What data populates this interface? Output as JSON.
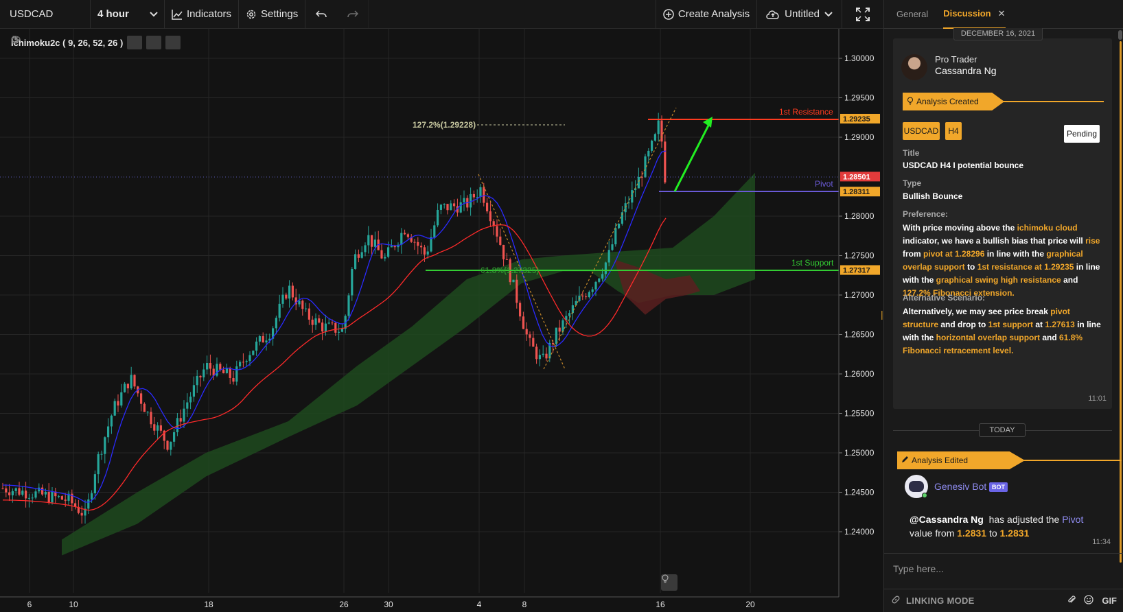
{
  "toolbar": {
    "symbol": "USDCAD",
    "interval": "4 hour",
    "indicators_label": "Indicators",
    "settings_label": "Settings",
    "create_analysis_label": "Create Analysis",
    "layout_name": "Untitled"
  },
  "chart": {
    "indicator_legend": "Ichimoku2c ( 9, 26, 52, 26 )",
    "price_axis": [
      "1.30000",
      "1.29500",
      "1.29000",
      "1.28000",
      "1.27500",
      "1.27000",
      "1.26500",
      "1.26000",
      "1.25500",
      "1.25000",
      "1.24500",
      "1.24000"
    ],
    "time_axis": [
      "6",
      "10",
      "18",
      "26",
      "30",
      "4",
      "8",
      "16",
      "20"
    ],
    "price_labels": [
      {
        "name": "resistance",
        "value": "1.29235",
        "color": "#f1a72a"
      },
      {
        "name": "last",
        "value": "1.28501",
        "color": "#e23b3b"
      },
      {
        "name": "pivot",
        "value": "1.28311",
        "color": "#f1a72a"
      },
      {
        "name": "support",
        "value": "1.27317",
        "color": "#f1a72a"
      }
    ],
    "annotations": {
      "resistance": "1st Resistance",
      "pivot": "Pivot",
      "support": "1st Support",
      "fib_ext": "127.2%(1.29228)",
      "fib_ret": "61.8%(1.27325)"
    },
    "colors": {
      "up": "#26a69a",
      "down": "#ef5350",
      "tenkan": "#2a2aff",
      "kijun": "#ff2a2a",
      "cloud_bull": "#1f4a1f",
      "cloud_bear": "#5a2020"
    }
  },
  "panel": {
    "tabs": [
      "General",
      "Discussion"
    ],
    "active_tab": "Discussion",
    "date_separator": "DECEMBER 16, 2021",
    "author_role": "Pro Trader",
    "author_name": "Cassandra Ng",
    "created_banner": "Analysis Created",
    "tag_symbol": "USDCAD",
    "tag_timeframe": "H4",
    "status": "Pending",
    "title_label": "Title",
    "title_value": "USDCAD H4 I potential bounce",
    "type_label": "Type",
    "type_value": "Bullish Bounce",
    "preference_label": "Preference:",
    "alternative_label": "Alternative Scenario:",
    "message_time": "11:01",
    "today_separator": "TODAY",
    "edited_banner": "Analysis Edited",
    "bot_name": "Genesiv Bot",
    "bot_badge": "BOT",
    "bot_time": "11:34",
    "compose_placeholder": "Type here...",
    "linking_mode": "LINKING MODE",
    "gif_label": "GIF"
  }
}
